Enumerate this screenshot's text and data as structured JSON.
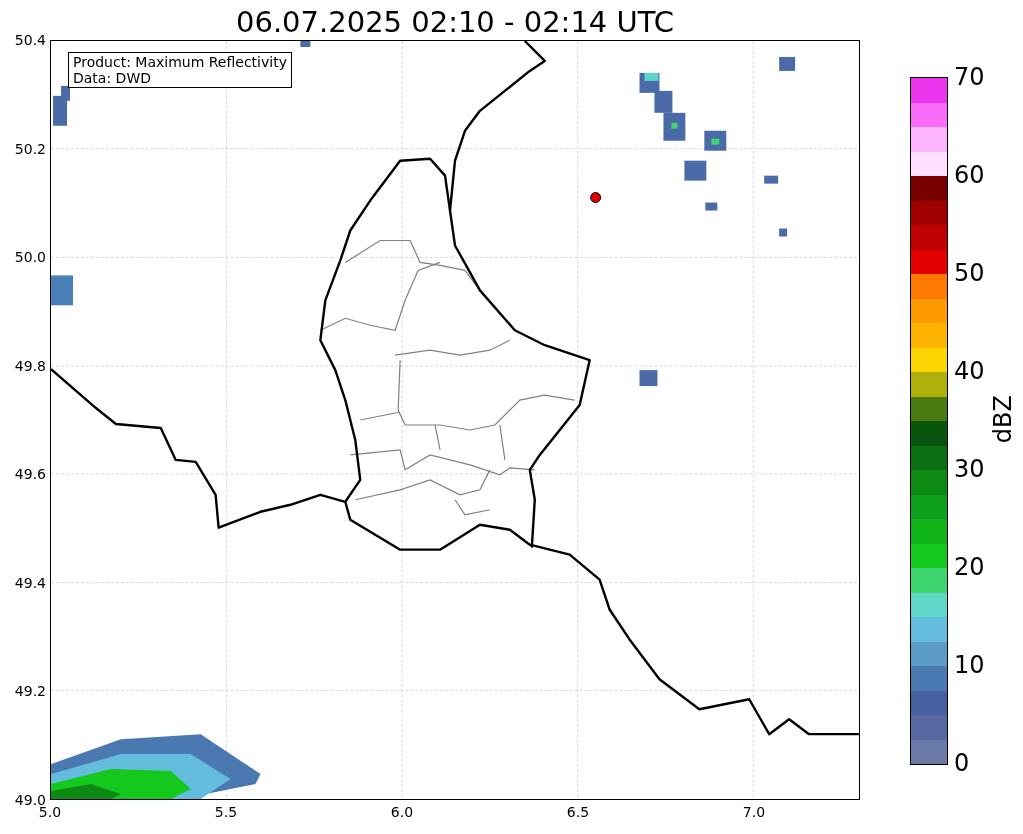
{
  "title": "06.07.2025 02:10 - 02:14 UTC",
  "annotation": [
    "Product: Maximum Reflectivity",
    "Data: DWD"
  ],
  "map": {
    "xticks": [
      "5.0",
      "5.5",
      "6.0",
      "6.5",
      "7.0"
    ],
    "yticks": [
      "50.4",
      "50.2",
      "50.0",
      "49.8",
      "49.6",
      "49.4",
      "49.2",
      "49.0"
    ]
  },
  "colorbar": {
    "label": "dBZ",
    "ticks": [
      "70",
      "60",
      "50",
      "40",
      "30",
      "20",
      "10",
      "0"
    ],
    "segments": [
      {
        "color": "#6a7aa8"
      },
      {
        "color": "#5868a0"
      },
      {
        "color": "#4660a0"
      },
      {
        "color": "#4a78b0"
      },
      {
        "color": "#5a9cc6"
      },
      {
        "color": "#64bcdc"
      },
      {
        "color": "#5ed6c8"
      },
      {
        "color": "#3ed470"
      },
      {
        "color": "#14c81e"
      },
      {
        "color": "#10b418"
      },
      {
        "color": "#0ea01a"
      },
      {
        "color": "#0c8a14"
      },
      {
        "color": "#0a7012"
      },
      {
        "color": "#08560e"
      },
      {
        "color": "#4a7a10"
      },
      {
        "color": "#b0b00a"
      },
      {
        "color": "#fcd600"
      },
      {
        "color": "#fcb400"
      },
      {
        "color": "#fc9a00"
      },
      {
        "color": "#fc7a00"
      },
      {
        "color": "#e40000"
      },
      {
        "color": "#c00000"
      },
      {
        "color": "#a00000"
      },
      {
        "color": "#780000"
      },
      {
        "color": "#fee0fe"
      },
      {
        "color": "#fcb4fc"
      },
      {
        "color": "#f86cf8"
      },
      {
        "color": "#ec34ec"
      }
    ]
  }
}
